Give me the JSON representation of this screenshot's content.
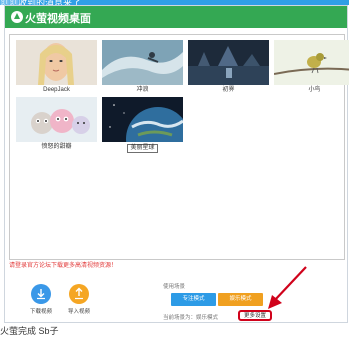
{
  "top_strip": {
    "text": "刚刚收到的消息来了"
  },
  "window": {
    "title": "火萤视频桌面"
  },
  "gallery": {
    "tiles": [
      {
        "label": "DeepJack"
      },
      {
        "label": "冲浪"
      },
      {
        "label": "初霁"
      },
      {
        "label": "小鸟"
      },
      {
        "label": "愤怒的甜瓣"
      },
      {
        "label": "美丽星球"
      }
    ]
  },
  "notice": "请登录官方论坛下载更多高清视频资源！",
  "actions": {
    "download": {
      "label": "下载视频",
      "icon": "download-icon",
      "color": "#3a98e8"
    },
    "import": {
      "label": "导入视频",
      "icon": "import-icon",
      "color": "#f5a623"
    }
  },
  "modes": {
    "title": "使用场景",
    "focus_label": "专注模式",
    "entertain_label": "娱乐模式",
    "current": "当前场景为：娱乐模式",
    "more_settings": "更多设置"
  },
  "caption": "火萤完成 Sb子",
  "colors": {
    "title_bar": "#34a853",
    "focus": "#2d9be6",
    "entertain": "#f0a020",
    "highlight": "#d0021b"
  }
}
